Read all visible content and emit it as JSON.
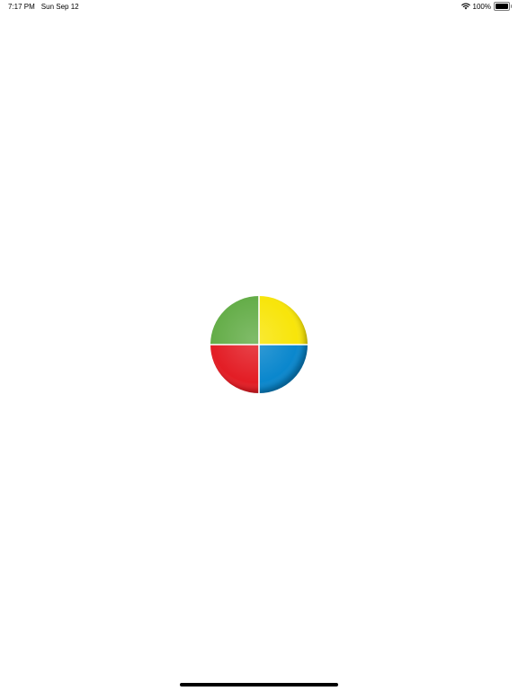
{
  "status_bar": {
    "time": "7:17 PM",
    "date": "Sun Sep 12",
    "battery_percent": "100%",
    "battery_level": 1.0,
    "icons": [
      "wifi-icon",
      "battery-icon"
    ]
  },
  "wheel": {
    "segments": [
      {
        "name": "green",
        "color": "#64ad48"
      },
      {
        "name": "yellow",
        "color": "#f8e50a"
      },
      {
        "name": "red",
        "color": "#e31d25"
      },
      {
        "name": "blue",
        "color": "#0a87cd"
      }
    ]
  },
  "colors": {
    "background": "#ffffff",
    "home_indicator": "#000000"
  }
}
